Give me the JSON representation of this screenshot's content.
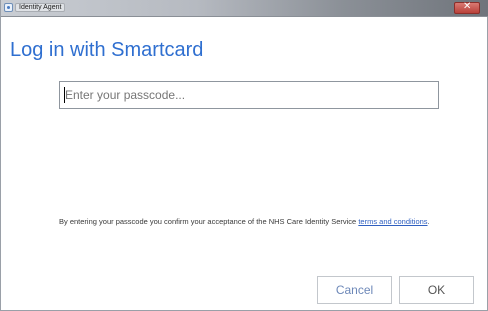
{
  "window": {
    "title": "Identity Agent",
    "close_glyph": "✕",
    "colors": {
      "heading": "#2f6fd0",
      "link": "#2f5fc0",
      "close_button": "#c24a43"
    }
  },
  "dialog": {
    "heading": "Log in with Smartcard",
    "passcode": {
      "placeholder": "Enter your passcode...",
      "value": ""
    },
    "consent": {
      "text": "By entering your passcode you confirm your acceptance of the NHS Care Identity Service ",
      "link_text": "terms and conditions",
      "suffix": "."
    },
    "buttons": {
      "cancel": "Cancel",
      "ok": "OK"
    }
  },
  "icons": {
    "app": "app-icon",
    "close": "close-icon"
  }
}
